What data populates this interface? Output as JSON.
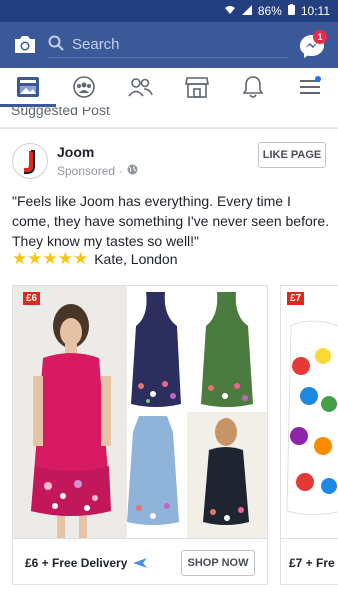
{
  "status": {
    "battery": "86%",
    "time": "10:11"
  },
  "header": {
    "search_placeholder": "Search",
    "messenger_badge": "1"
  },
  "nav": [
    "news-feed",
    "groups",
    "friends",
    "marketplace",
    "notifications",
    "menu"
  ],
  "suggested": {
    "label": "Suggested Post",
    "more": "···"
  },
  "post": {
    "page_name": "Joom",
    "sponsored": "Sponsored",
    "like_button": "LIKE PAGE",
    "text": "\"Feels like Joom has everything. Every time I come, they have something I've never seen before. They know my tastes so well!\"",
    "stars": "★★★★★",
    "reviewer": "Kate, London"
  },
  "cards": [
    {
      "badge": "£6",
      "title": "£6 + Free Delivery",
      "cta": "SHOP NOW"
    },
    {
      "badge": "£7",
      "title": "£7 + Fre"
    }
  ],
  "colors": {
    "brand": "#3b5998",
    "badge": "#e0291d"
  }
}
